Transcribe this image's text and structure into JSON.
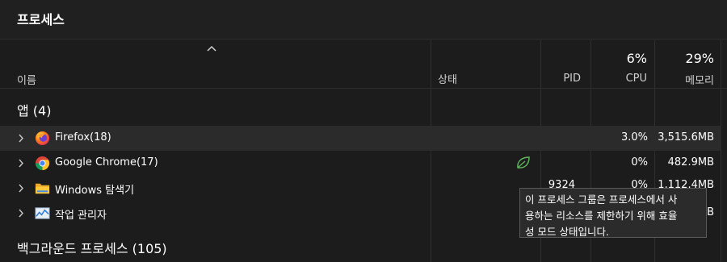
{
  "window": {
    "title": "프로세스"
  },
  "columns": {
    "name": "이름",
    "status": "상태",
    "pid": "PID",
    "cpu": {
      "label": "CPU",
      "percent": "6%"
    },
    "memory": {
      "label": "메모리",
      "percent": "29%"
    }
  },
  "groups": {
    "apps": "앱 (4)",
    "background": "백그라운드 프로세스 (105)"
  },
  "rows": [
    {
      "name": "Firefox(18)",
      "pid": "",
      "cpu": "3.0%",
      "memory": "3,515.6MB",
      "icon": "firefox-icon"
    },
    {
      "name": "Google Chrome(17)",
      "pid": "",
      "cpu": "0%",
      "memory": "482.9MB",
      "icon": "chrome-icon",
      "status_icon": "efficiency-leaf-icon"
    },
    {
      "name": "Windows 탐색기",
      "pid": "9324",
      "cpu": "0%",
      "memory": "1,112.4MB",
      "icon": "folder-icon"
    },
    {
      "name": "작업 관리자",
      "pid": "",
      "cpu": "",
      "memory": "MB",
      "icon": "task-manager-icon"
    }
  ],
  "tooltip": {
    "line1": "이 프로세스 그룹은 프로세스에서 사",
    "line2": "용하는 리소스를 제한하기 위해 효율",
    "line3": "성 모드 상태입니다."
  },
  "colors": {
    "background": "#1c1c1c",
    "row_highlight": "#2b2b2b",
    "efficiency_green": "#5fb35c"
  }
}
